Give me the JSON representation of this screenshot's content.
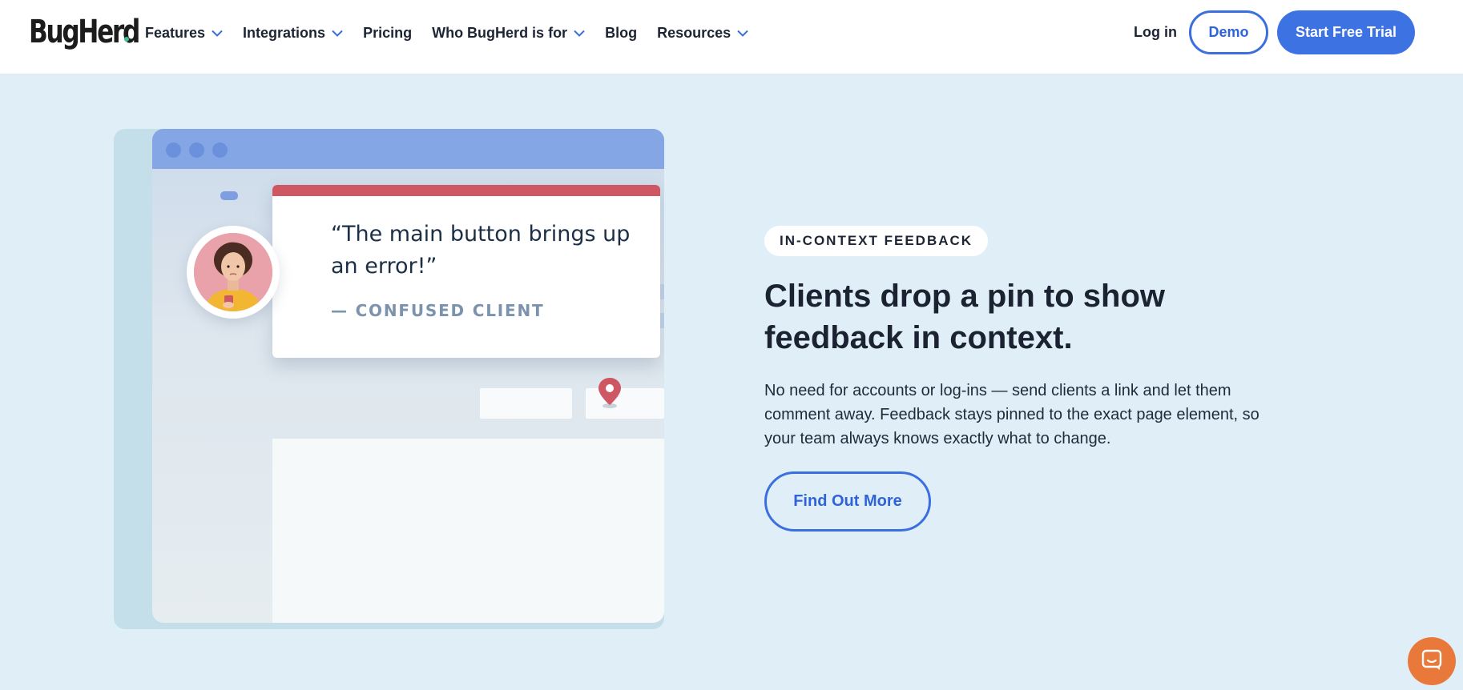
{
  "header": {
    "logo_text": "BugHerd",
    "nav": [
      {
        "label": "Features",
        "has_dropdown": true
      },
      {
        "label": "Integrations",
        "has_dropdown": true
      },
      {
        "label": "Pricing",
        "has_dropdown": false
      },
      {
        "label": "Who BugHerd is for",
        "has_dropdown": true
      },
      {
        "label": "Blog",
        "has_dropdown": false
      },
      {
        "label": "Resources",
        "has_dropdown": true
      }
    ],
    "login_label": "Log in",
    "demo_label": "Demo",
    "trial_label": "Start Free Trial"
  },
  "illustration": {
    "quote": "“The main button brings up an error!”",
    "attribution": "— CONFUSED CLIENT",
    "pin_icon": "map-pin-icon"
  },
  "feature": {
    "badge": "IN-CONTEXT FEEDBACK",
    "headline": "Clients drop a pin to show feedback in context.",
    "body": "No need for accounts or log-ins — send clients a link and let them comment away. Feedback stays pinned to the exact page element, so your team always knows exactly what to change.",
    "cta_label": "Find Out More"
  },
  "chat_widget": {
    "icon": "chat-icon"
  },
  "colors": {
    "accent": "#3d72e3",
    "background": "#e0eff7",
    "quote_bar": "#cf5763",
    "chat": "#e9793a"
  }
}
